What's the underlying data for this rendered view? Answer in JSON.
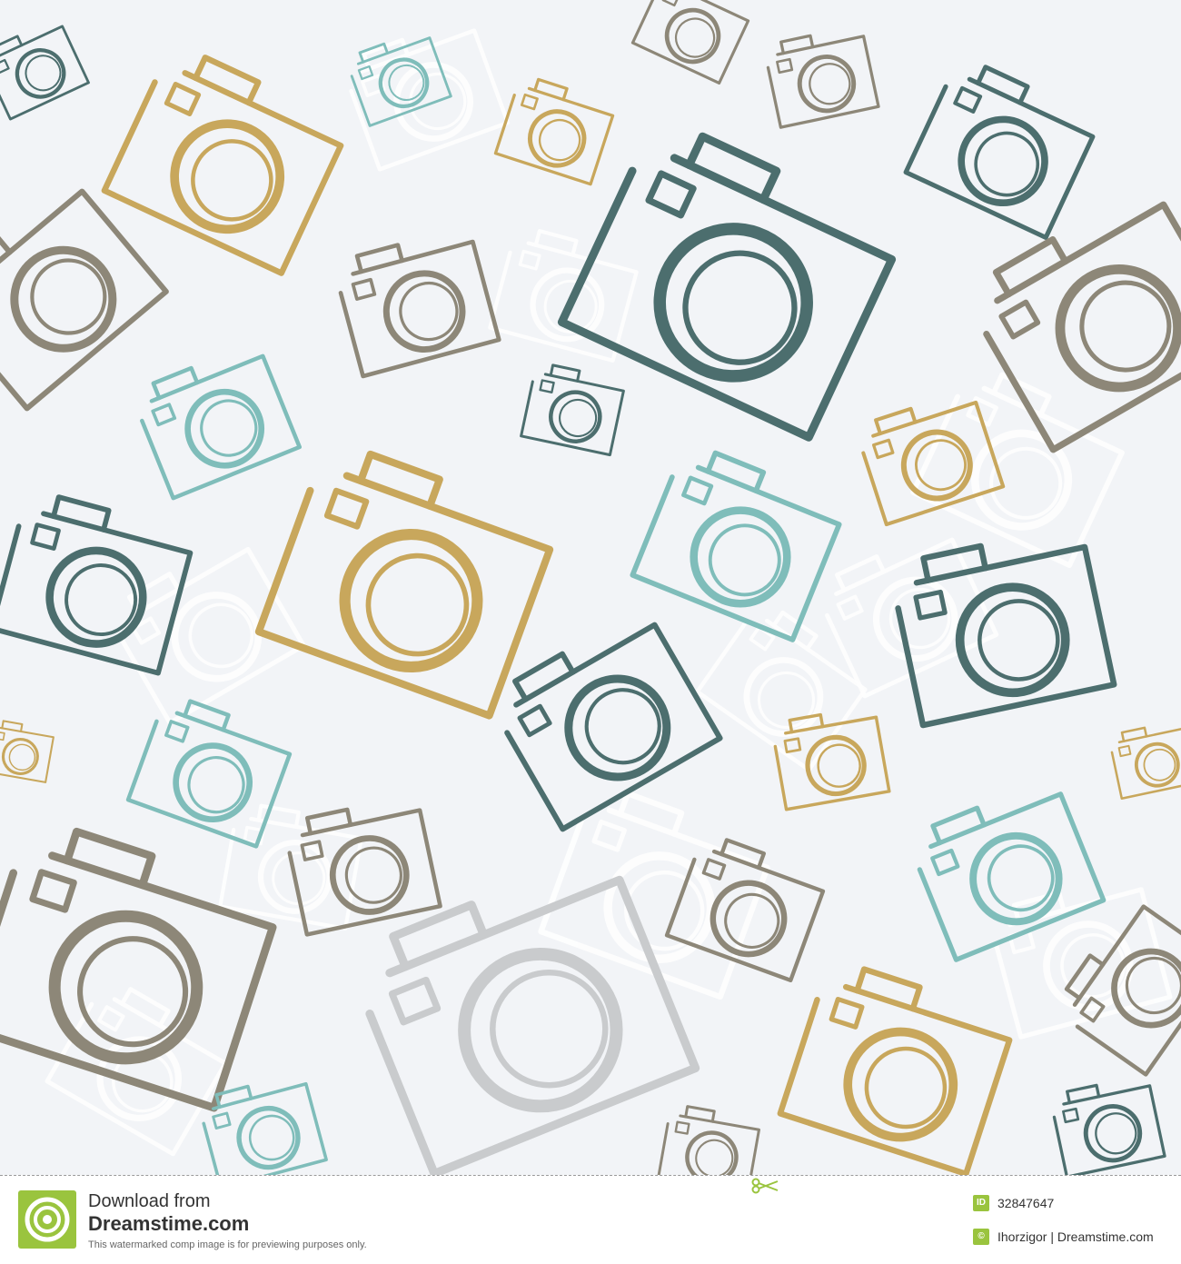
{
  "colors": {
    "background": "#f2f4f7",
    "teal_dark": "#4c6e6e",
    "teal_light": "#7fbdba",
    "mustard": "#c8a75c",
    "taupe": "#8d8778",
    "silver": "#c9cbcd",
    "ghost": "#ffffff",
    "brand_green": "#9ac43e"
  },
  "footer": {
    "download_label": "Download from",
    "site_name": "Dreamstime.com",
    "note": "This watermarked comp image is for previewing purposes only.",
    "id_badge": "ID",
    "id_value": "32847647",
    "copyright_badge": "©",
    "credit": "Ihorzigor | Dreamstime.com"
  },
  "icons": {
    "logo": "dreamstime-spiral-logo",
    "scissors": "scissors-icon",
    "pattern_motif": "camera-outline-icon"
  }
}
